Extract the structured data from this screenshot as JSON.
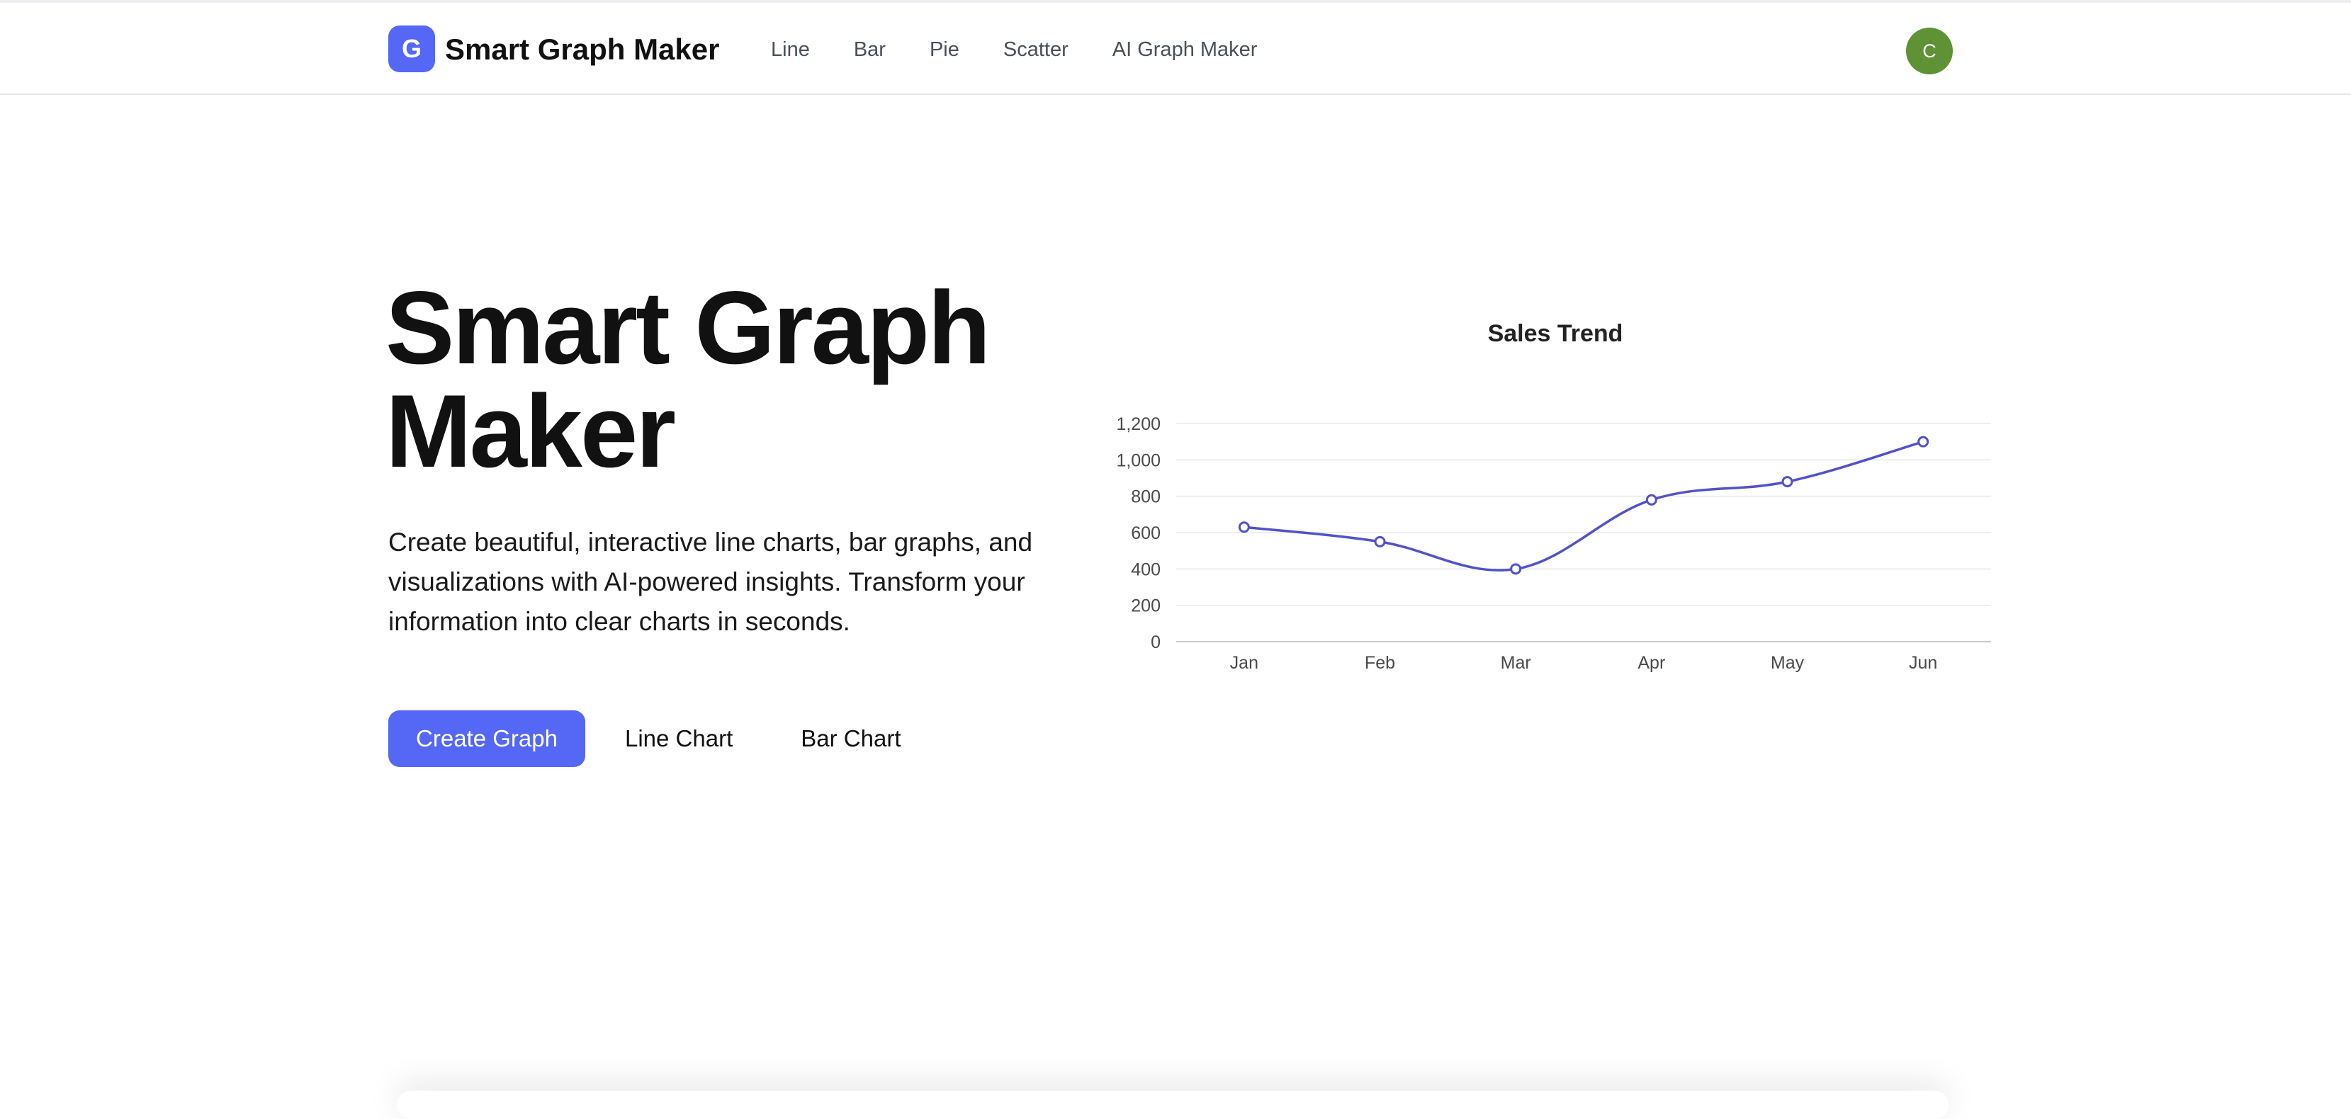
{
  "app": {
    "logo_letter": "G",
    "name": "Smart Graph Maker",
    "nav": [
      "Line",
      "Bar",
      "Pie",
      "Scatter",
      "AI Graph Maker"
    ],
    "avatar_letter": "C"
  },
  "hero": {
    "title": "Smart Graph Maker",
    "subtitle": "Create beautiful, interactive line charts, bar graphs, and visualizations with AI-powered insights. Transform your information into clear charts in seconds.",
    "primary_button": "Create Graph",
    "secondary_buttons": [
      "Line Chart",
      "Bar Chart"
    ]
  },
  "colors": {
    "accent": "#5468f5",
    "avatar": "#5f9235",
    "line": "#5252c9",
    "grid": "#e7e8eb",
    "axis": "#c7c9ce",
    "tick_text": "#4a4a4a"
  },
  "chart_data": {
    "type": "line",
    "title": "Sales Trend",
    "categories": [
      "Jan",
      "Feb",
      "Mar",
      "Apr",
      "May",
      "Jun"
    ],
    "values": [
      630,
      550,
      400,
      780,
      880,
      1100
    ],
    "ylim": [
      0,
      1200
    ],
    "yticks": [
      0,
      200,
      400,
      600,
      800,
      1000,
      1200
    ],
    "ytick_labels": [
      "0",
      "200",
      "400",
      "600",
      "800",
      "1,000",
      "1,200"
    ],
    "xlabel": "",
    "ylabel": "",
    "grid": true,
    "legend": "none",
    "smooth": true
  }
}
